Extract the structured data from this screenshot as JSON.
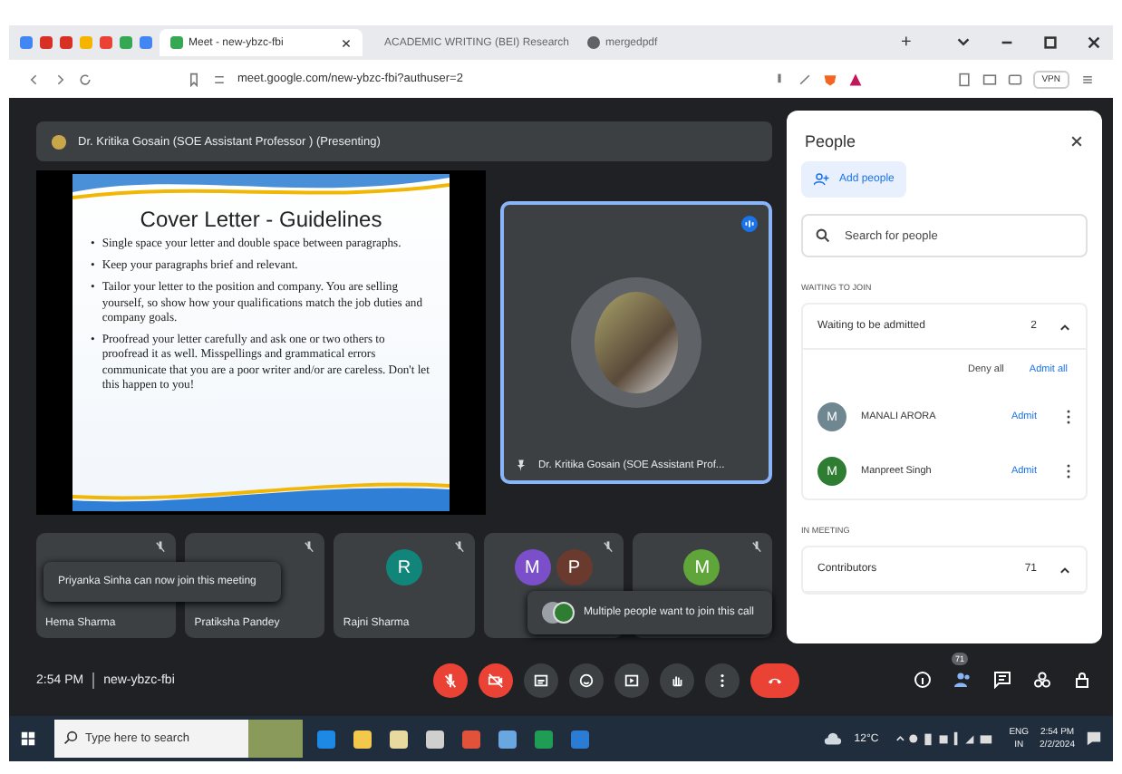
{
  "browser": {
    "tabs": [
      {
        "title": "Meet - new-ybzc-fbi",
        "selected": true,
        "kind": "meet"
      },
      {
        "title": "ACADEMIC WRITING (BEI) Research",
        "selected": false,
        "kind": "doc"
      },
      {
        "title": "mergedpdf",
        "selected": false,
        "kind": "web"
      }
    ],
    "new_tab": "+",
    "address": "meet.google.com/new-ybzc-fbi?authuser=2",
    "vpn": "VPN"
  },
  "meet": {
    "presenter_bar": "Dr. Kritika Gosain (SOE Assistant Professor ) (Presenting)",
    "slide": {
      "title": "Cover Letter - Guidelines",
      "bullet_marker": "•",
      "bullets": [
        "Single space your letter and double space between paragraphs.",
        "Keep your paragraphs brief and relevant.",
        "Tailor your letter to the position and company. You are selling yourself, so show how your qualifications match the job duties and company goals.",
        "Proofread your letter carefully and ask one or two others to proofread it as well. Misspellings and grammatical errors communicate that you are a poor writer and/or are careless. Don't let this happen to you!"
      ]
    },
    "speaker_tile": {
      "name": "Dr. Kritika Gosain (SOE Assistant Prof...",
      "speaking": true
    },
    "tiles": [
      {
        "name": "Hema Sharma"
      },
      {
        "name": "Pratiksha Pandey"
      },
      {
        "name": "Rajni Sharma",
        "avatars": [
          {
            "letter": "R",
            "color": "#12857a"
          }
        ]
      },
      {
        "avatars": [
          {
            "letter": "M",
            "color": "#7b4fc9"
          },
          {
            "letter": "P",
            "color": "#6b3a2e"
          }
        ]
      },
      {
        "avatars": [
          {
            "letter": "M",
            "color": "#5fa53a"
          }
        ]
      }
    ],
    "toasts": [
      {
        "text": "Priyanka Sinha can now join this meeting",
        "kind": "plain"
      },
      {
        "text": "Multiple people want to join this call",
        "kind": "avatars"
      }
    ],
    "time": "2:54 PM",
    "meeting_code": "new-ybzc-fbi",
    "controls": [
      {
        "kind": "mic",
        "off": true
      },
      {
        "kind": "camera",
        "off": true
      },
      {
        "kind": "captions",
        "off": false
      },
      {
        "kind": "emoji",
        "off": false
      },
      {
        "kind": "present",
        "off": false
      },
      {
        "kind": "hand",
        "off": false
      },
      {
        "kind": "more",
        "off": false
      },
      {
        "kind": "leave",
        "off": true
      }
    ],
    "side_controls": [
      {
        "kind": "info"
      },
      {
        "kind": "people",
        "badge": "71"
      },
      {
        "kind": "chat"
      },
      {
        "kind": "activities"
      },
      {
        "kind": "lock"
      }
    ]
  },
  "people_panel": {
    "title": "People",
    "add_button": "Add people",
    "search": {
      "placeholder": "Search for people"
    },
    "waiting_heading": "WAITING TO JOIN",
    "waiting_label": "Waiting to be admitted",
    "waiting_count": "2",
    "deny_all": "Deny all",
    "admit_all": "Admit all",
    "waiting": [
      {
        "initial": "M",
        "name": "MANALI ARORA",
        "color": "#6f8791",
        "action": "Admit"
      },
      {
        "initial": "M",
        "name": "Manpreet Singh",
        "color": "#2e7d32",
        "action": "Admit"
      }
    ],
    "in_meeting_heading": "IN MEETING",
    "contributors_label": "Contributors",
    "contributors_count": "71"
  },
  "taskbar": {
    "search": {
      "placeholder": "Type here to search"
    },
    "weather": "12°C",
    "language": "ENG",
    "region": "IN",
    "time": "2:54 PM",
    "date": "2/2/2024"
  }
}
